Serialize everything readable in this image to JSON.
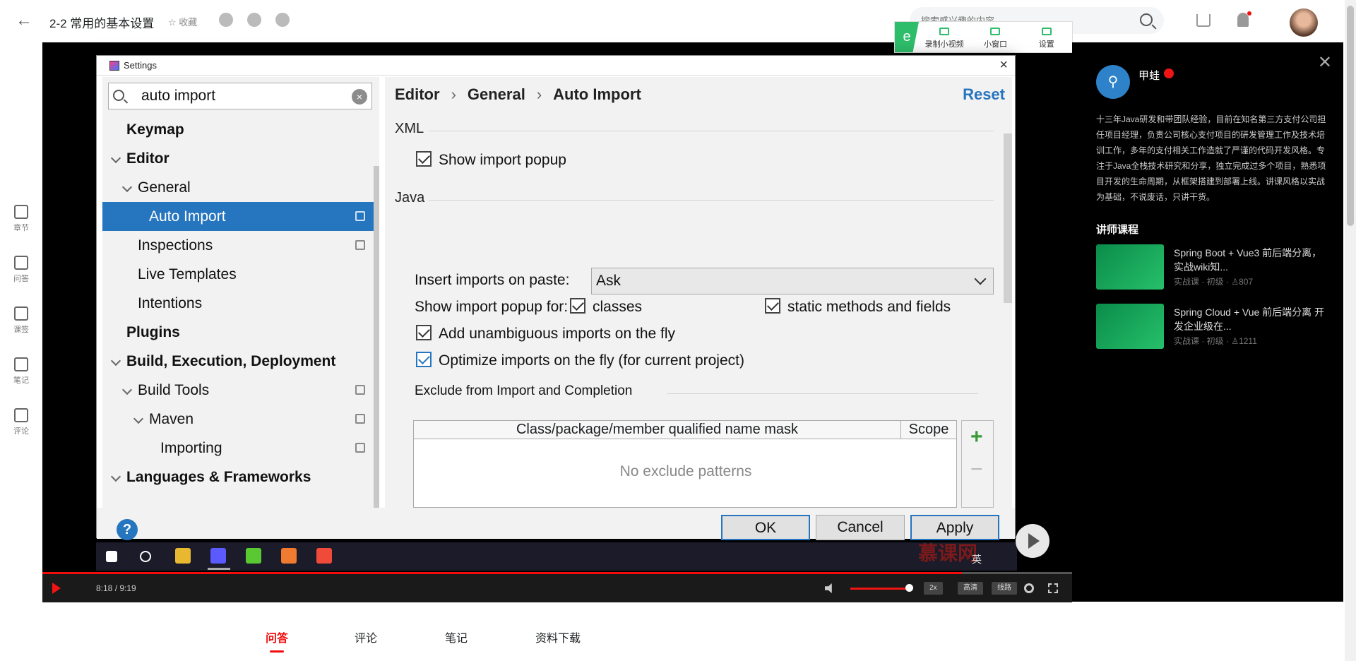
{
  "header": {
    "course_title": "2-2 常用的基本设置",
    "favorite_label": "☆ 收藏",
    "search_placeholder": "搜索感兴趣的内容"
  },
  "recorder": {
    "record_label": "录制小视频",
    "mini_window_label": "小窗口",
    "settings_label": "设置"
  },
  "left_rail": [
    {
      "label": "章节",
      "icon": "chapter-icon"
    },
    {
      "label": "问答",
      "icon": "qa-icon"
    },
    {
      "label": "课签",
      "icon": "bookmark-icon"
    },
    {
      "label": "笔记",
      "icon": "note-icon"
    },
    {
      "label": "评论",
      "icon": "comment-icon"
    }
  ],
  "dialog": {
    "title": "Settings",
    "search_value": "auto import",
    "tree": [
      {
        "label": "Keymap",
        "level": 0,
        "bold": true,
        "expanded": false,
        "copy": false
      },
      {
        "label": "Editor",
        "level": 0,
        "bold": true,
        "expanded": true,
        "copy": false
      },
      {
        "label": "General",
        "level": 1,
        "bold": false,
        "expanded": true,
        "copy": false
      },
      {
        "label": "Auto Import",
        "level": 2,
        "bold": false,
        "selected": true,
        "copy": true
      },
      {
        "label": "Inspections",
        "level": 1,
        "bold": false,
        "copy": true
      },
      {
        "label": "Live Templates",
        "level": 1,
        "bold": false,
        "copy": false
      },
      {
        "label": "Intentions",
        "level": 1,
        "bold": false,
        "copy": false
      },
      {
        "label": "Plugins",
        "level": 0,
        "bold": true,
        "copy": false
      },
      {
        "label": "Build, Execution, Deployment",
        "level": 0,
        "bold": true,
        "expanded": true,
        "copy": false
      },
      {
        "label": "Build Tools",
        "level": 1,
        "bold": false,
        "expanded": true,
        "copy": true
      },
      {
        "label": "Maven",
        "level": 2,
        "bold": false,
        "expanded": true,
        "copy": true
      },
      {
        "label": "Importing",
        "level": 3,
        "bold": false,
        "copy": true
      },
      {
        "label": "Languages & Frameworks",
        "level": 0,
        "bold": true,
        "expanded": true,
        "copy": false
      }
    ],
    "breadcrumb": [
      "Editor",
      "General",
      "Auto Import"
    ],
    "reset_label": "Reset",
    "xml_section": "XML",
    "xml_show_popup": "Show import popup",
    "java_section": "Java",
    "insert_on_paste_label": "Insert imports on paste:",
    "insert_on_paste_value": "Ask",
    "show_popup_for_label": "Show import popup for:",
    "classes_label": "classes",
    "static_label": "static methods and fields",
    "add_unambiguous_label": "Add unambiguous imports on the fly",
    "optimize_label": "Optimize imports on the fly (for current project)",
    "exclude_section": "Exclude from Import and Completion",
    "table_col_mask": "Class/package/member qualified name mask",
    "table_col_scope": "Scope",
    "table_empty": "No exclude patterns",
    "ok_label": "OK",
    "cancel_label": "Cancel",
    "apply_label": "Apply"
  },
  "player": {
    "time": "8:18 / 9:19",
    "progress": 0.893,
    "speed": "2x",
    "quality": "高清",
    "route": "线路"
  },
  "teacher": {
    "name": "甲蛙",
    "bio": "十三年Java研发和带团队经验，目前在知名第三方支付公司担任项目经理，负责公司核心支付项目的研发管理工作及技术培训工作，多年的支付相关工作造就了严谨的代码开发风格。专注于Java全栈技术研究和分享，独立完成过多个项目，熟悉项目开发的生命周期，从框架搭建到部署上线。讲课风格以实战为基础，不说废话，只讲干货。",
    "courses_title": "讲师课程",
    "courses": [
      {
        "name": "Spring Boot + Vue3 前后端分离，实战wiki知...",
        "meta": "实战课 · 初级 · ♙807"
      },
      {
        "name": "Spring Cloud + Vue 前后端分离 开发企业级在...",
        "meta": "实战课 · 初级 · ♙1211"
      }
    ]
  },
  "tray_text": "英",
  "watermark": "慕课网",
  "bottom_tabs": [
    {
      "label": "问答",
      "active": true
    },
    {
      "label": "评论",
      "active": false
    },
    {
      "label": "笔记",
      "active": false
    },
    {
      "label": "资料下载",
      "active": false
    }
  ],
  "colors": {
    "accent": "#f20d0d",
    "ide_selection": "#2675bf",
    "ide_link": "#2675bf"
  }
}
